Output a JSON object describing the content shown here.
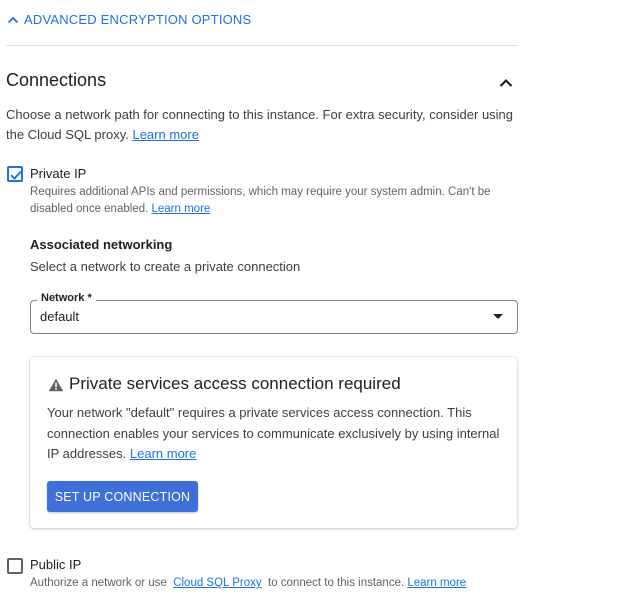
{
  "advanced": {
    "label": "ADVANCED ENCRYPTION OPTIONS"
  },
  "connections": {
    "title": "Connections",
    "description": "Choose a network path for connecting to this instance. For extra security, consider using the Cloud SQL proxy.",
    "learn_more": "Learn more"
  },
  "private_ip": {
    "label": "Private IP",
    "checked": true,
    "help": "Requires additional APIs and permissions, which may require your system admin. Can't be disabled once enabled.",
    "learn_more": "Learn more"
  },
  "networking": {
    "heading": "Associated networking",
    "subtext": "Select a network to create a private connection",
    "network_label": "Network *",
    "network_value": "default"
  },
  "psa_card": {
    "title": "Private services access connection required",
    "body": "Your network \"default\" requires a private services access connection. This connection enables your services to communicate exclusively by using internal IP addresses.",
    "learn_more": "Learn more",
    "button": "SET UP CONNECTION"
  },
  "public_ip": {
    "label": "Public IP",
    "checked": false,
    "help_prefix": "Authorize a network or use",
    "proxy_link": "Cloud SQL Proxy",
    "help_suffix": "to connect to this instance.",
    "learn_more": "Learn more"
  },
  "colors": {
    "accent": "#1a73e8",
    "button": "#3f6fd8",
    "divider": "#dadce0"
  }
}
